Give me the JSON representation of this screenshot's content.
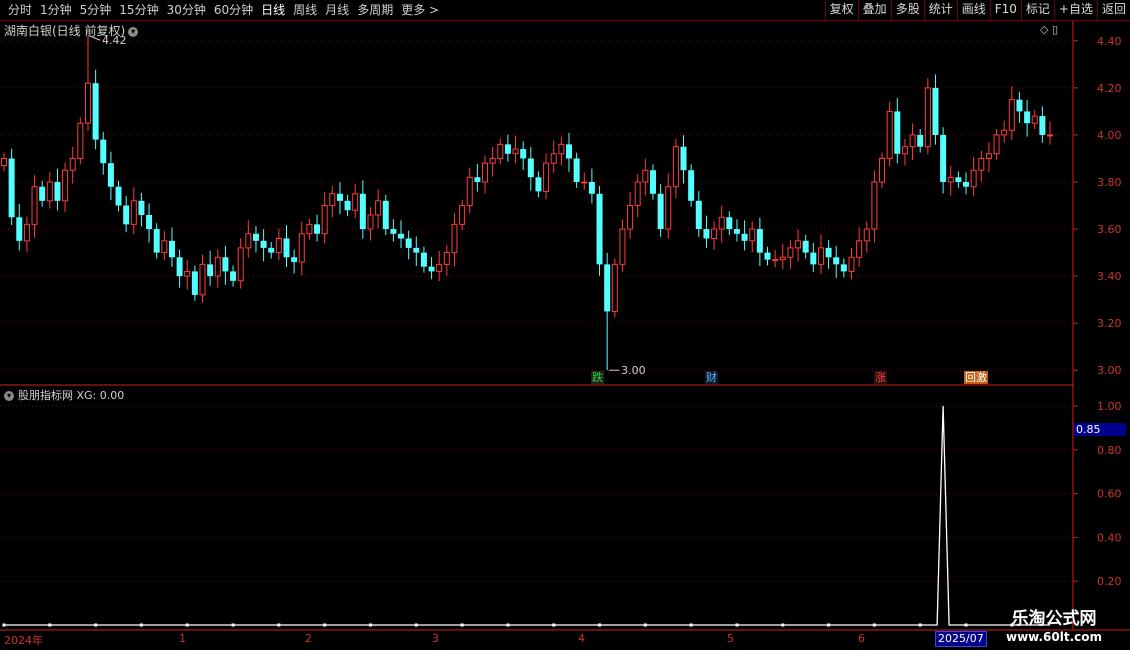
{
  "toolbar": {
    "periods": [
      "分时",
      "1分钟",
      "5分钟",
      "15分钟",
      "30分钟",
      "60分钟",
      "日线",
      "周线",
      "月线",
      "多周期",
      "更多 >"
    ],
    "active": "日线",
    "actions": [
      "复权",
      "叠加",
      "多股",
      "统计",
      "画线",
      "F10",
      "标记",
      "+自选",
      "返回"
    ]
  },
  "main": {
    "title": "湖南白银(日线 前复权)",
    "high_label": "4.42",
    "low_label": "3.00"
  },
  "indicator": {
    "title": "股朋指标网 XG: 0.00",
    "current_value": "0.85"
  },
  "events": [
    {
      "label": "跌",
      "color": "#2ecc40",
      "bg": "#1a2a1a"
    },
    {
      "label": "财",
      "color": "#5ab4ff",
      "bg": "#0e1a2a"
    },
    {
      "label": "涨",
      "color": "#ff4040",
      "bg": "#2a0e0e"
    },
    {
      "label": "回激",
      "color": "#ffffff",
      "bg": "#c05a10"
    }
  ],
  "dates": {
    "start": "2024年",
    "months": [
      "1",
      "2",
      "3",
      "4",
      "5",
      "6"
    ],
    "end": "2025/07"
  },
  "watermark": {
    "line1": "乐淘公式网",
    "line2": "www.60lt.com"
  },
  "colors": {
    "up": "#ff3c3c",
    "down": "#54ffff",
    "grid": "#7a0000",
    "axis": "#cc2020",
    "label": "#cc3333"
  },
  "chart_data": [
    {
      "type": "candlestick",
      "title": "湖南白银(日线 前复权)",
      "ylim": [
        2.95,
        4.48
      ],
      "yticks": [
        3.0,
        3.2,
        3.4,
        3.6,
        3.8,
        4.0,
        4.2,
        4.4
      ],
      "annotations": [
        {
          "label": "4.42",
          "value": 4.42
        },
        {
          "label": "3.00",
          "value": 3.0
        }
      ],
      "closes": [
        3.9,
        3.65,
        3.55,
        3.62,
        3.78,
        3.72,
        3.8,
        3.72,
        3.85,
        3.9,
        4.05,
        4.22,
        3.98,
        3.88,
        3.78,
        3.7,
        3.62,
        3.72,
        3.66,
        3.6,
        3.5,
        3.55,
        3.48,
        3.4,
        3.42,
        3.32,
        3.45,
        3.4,
        3.48,
        3.42,
        3.38,
        3.52,
        3.58,
        3.55,
        3.52,
        3.5,
        3.56,
        3.48,
        3.46,
        3.58,
        3.62,
        3.58,
        3.7,
        3.75,
        3.72,
        3.68,
        3.75,
        3.6,
        3.66,
        3.72,
        3.6,
        3.58,
        3.56,
        3.52,
        3.5,
        3.44,
        3.42,
        3.45,
        3.5,
        3.62,
        3.7,
        3.82,
        3.8,
        3.88,
        3.9,
        3.96,
        3.92,
        3.94,
        3.9,
        3.82,
        3.76,
        3.88,
        3.92,
        3.96,
        3.9,
        3.8,
        3.8,
        3.75,
        3.45,
        3.25,
        3.45,
        3.6,
        3.7,
        3.8,
        3.85,
        3.75,
        3.6,
        3.78,
        3.95,
        3.85,
        3.72,
        3.6,
        3.56,
        3.6,
        3.65,
        3.6,
        3.58,
        3.55,
        3.6,
        3.5,
        3.47,
        3.47,
        3.48,
        3.52,
        3.55,
        3.5,
        3.45,
        3.52,
        3.48,
        3.45,
        3.42,
        3.48,
        3.55,
        3.6,
        3.8,
        3.9,
        4.1,
        3.92,
        3.95,
        4.0,
        3.95,
        4.2,
        4.0,
        3.8,
        3.82,
        3.8,
        3.78,
        3.85,
        3.9,
        3.92,
        4.0,
        4.02,
        4.15,
        4.1,
        4.05,
        4.08,
        4.0,
        4.0
      ],
      "high": 4.42,
      "low": 3.0
    },
    {
      "type": "line",
      "title": "股朋指标网 XG: 0.00",
      "ylim": [
        0,
        1.05
      ],
      "yticks": [
        0.2,
        0.4,
        0.6,
        0.8,
        1.0
      ],
      "series": [
        {
          "name": "XG",
          "spike_index": 123,
          "spike_value": 1.0
        }
      ],
      "current": 0.85
    }
  ]
}
